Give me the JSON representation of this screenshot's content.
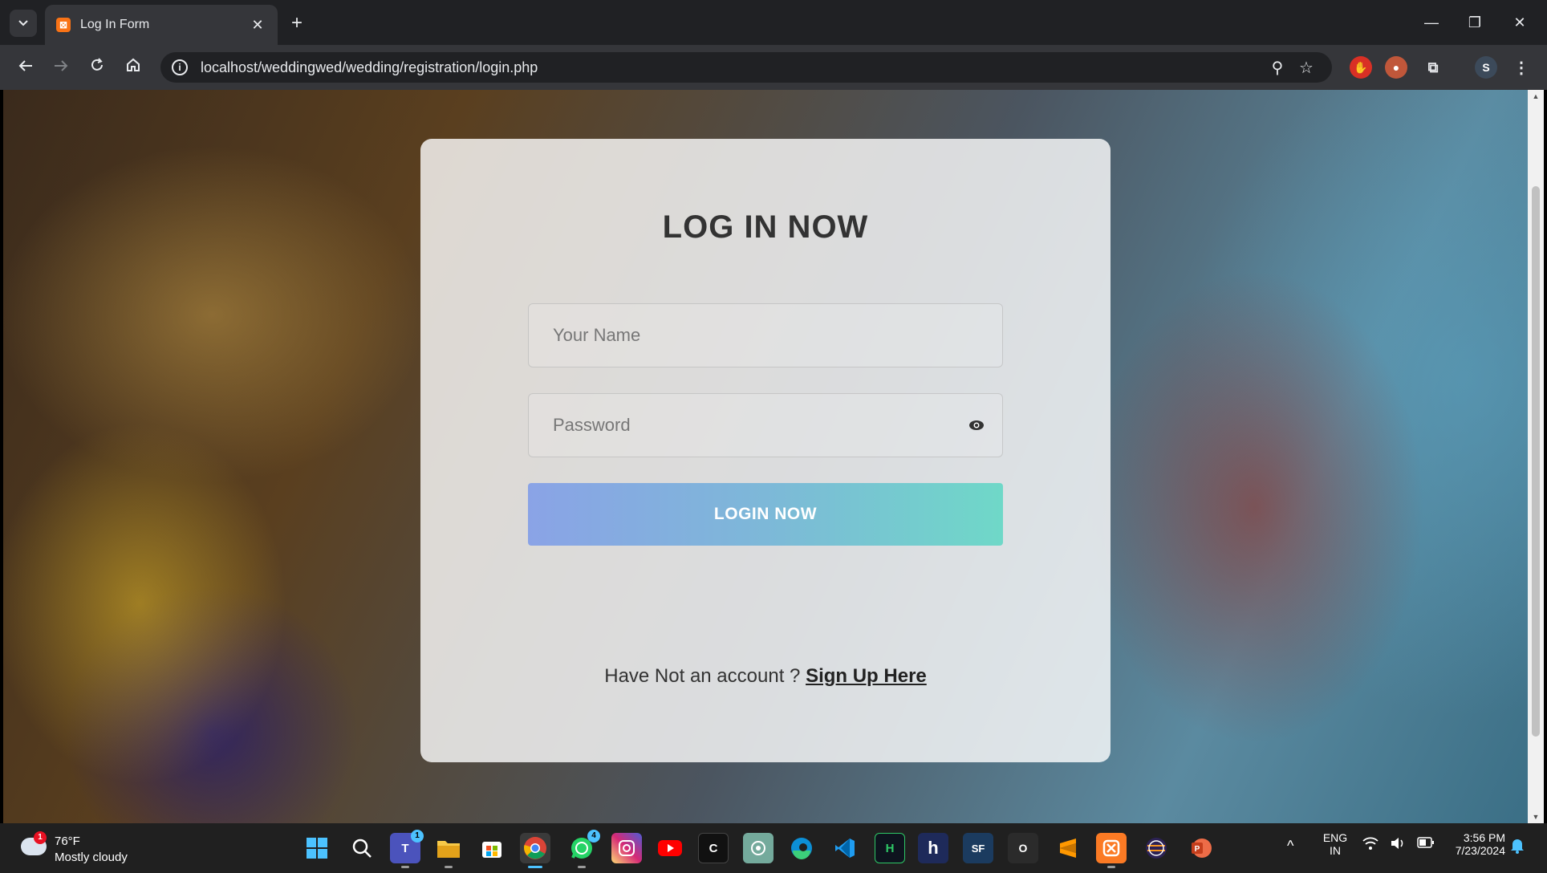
{
  "browser": {
    "tab_title": "Log In Form",
    "url": "localhost/weddingwed/wedding/registration/login.php",
    "profile_initial": "S"
  },
  "login_form": {
    "title": "LOG IN NOW",
    "name_placeholder": "Your Name",
    "password_placeholder": "Password",
    "login_button": "LOGIN NOW",
    "signup_prompt": "Have Not an account ? ",
    "signup_link": "Sign Up Here"
  },
  "taskbar": {
    "weather_badge": "1",
    "temperature": "76°F",
    "condition": "Mostly cloudy",
    "language_top": "ENG",
    "language_bottom": "IN",
    "time": "3:56 PM",
    "date": "7/23/2024",
    "apps": [
      {
        "name": "start-icon",
        "label": ""
      },
      {
        "name": "search-icon",
        "label": ""
      },
      {
        "name": "teams-icon",
        "label": "T",
        "badge": "1"
      },
      {
        "name": "file-explorer-icon",
        "label": ""
      },
      {
        "name": "store-icon",
        "label": ""
      },
      {
        "name": "chrome-icon",
        "label": ""
      },
      {
        "name": "whatsapp-icon",
        "label": "",
        "badge": "4"
      },
      {
        "name": "instagram-icon",
        "label": ""
      },
      {
        "name": "youtube-icon",
        "label": ""
      },
      {
        "name": "capcut-icon",
        "label": "C"
      },
      {
        "name": "chatgpt-icon",
        "label": ""
      },
      {
        "name": "edge-icon",
        "label": ""
      },
      {
        "name": "vscode-icon",
        "label": ""
      },
      {
        "name": "hackerrank-icon",
        "label": "H"
      },
      {
        "name": "h-app-icon",
        "label": "h"
      },
      {
        "name": "sf-app-icon",
        "label": "SF"
      },
      {
        "name": "o-app-icon",
        "label": "O"
      },
      {
        "name": "sublime-icon",
        "label": ""
      },
      {
        "name": "xampp-icon",
        "label": ""
      },
      {
        "name": "eclipse-icon",
        "label": ""
      },
      {
        "name": "powerpoint-icon",
        "label": "P"
      }
    ]
  },
  "colors": {
    "chrome_dark": "#202124",
    "chrome_toolbar": "#35363a",
    "button_gradient_start": "#8aa3e6",
    "button_gradient_end": "#6fd8c8",
    "taskbar": "#202020"
  }
}
